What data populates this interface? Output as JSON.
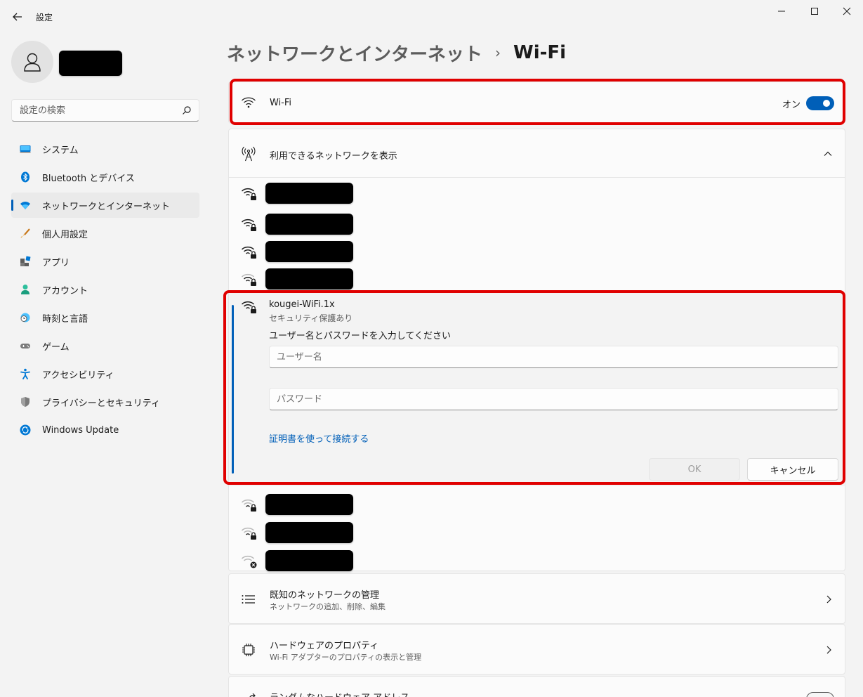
{
  "window": {
    "title": "設定",
    "controls": [
      "minimize",
      "maximize",
      "close"
    ]
  },
  "sidebar": {
    "search": {
      "placeholder": "設定の検索"
    },
    "items": [
      {
        "label": "システム",
        "icon": "system-display-icon"
      },
      {
        "label": "Bluetooth とデバイス",
        "icon": "bluetooth-icon"
      },
      {
        "label": "ネットワークとインターネット",
        "icon": "network-wifi-icon",
        "active": true
      },
      {
        "label": "個人用設定",
        "icon": "paintbrush-icon"
      },
      {
        "label": "アプリ",
        "icon": "apps-icon"
      },
      {
        "label": "アカウント",
        "icon": "account-icon"
      },
      {
        "label": "時刻と言語",
        "icon": "clock-globe-icon"
      },
      {
        "label": "ゲーム",
        "icon": "gamepad-icon"
      },
      {
        "label": "アクセシビリティ",
        "icon": "accessibility-icon"
      },
      {
        "label": "プライバシーとセキュリティ",
        "icon": "shield-icon"
      },
      {
        "label": "Windows Update",
        "icon": "windows-update-icon"
      }
    ]
  },
  "breadcrumb": {
    "parent": "ネットワークとインターネット",
    "separator": "›",
    "current": "Wi-Fi"
  },
  "wifi_toggle": {
    "label": "Wi-Fi",
    "state_label": "オン",
    "on": true
  },
  "networks": {
    "header": "利用できるネットワークを表示",
    "expanded": {
      "name": "kougei-WiFi.1x",
      "security": "セキュリティ保護あり",
      "prompt": "ユーザー名とパスワードを入力してください",
      "username_placeholder": "ユーザー名",
      "password_placeholder": "パスワード",
      "cert_link": "証明書を使って接続する",
      "ok_label": "OK",
      "cancel_label": "キャンセル"
    }
  },
  "settings_rows": [
    {
      "title": "既知のネットワークの管理",
      "subtitle": "ネットワークの追加、削除、編集"
    },
    {
      "title": "ハードウェアのプロパティ",
      "subtitle": "Wi-Fi アダプターのプロパティの表示と管理"
    },
    {
      "title": "ランダムなハードウェア アドレス"
    }
  ],
  "colors": {
    "accent": "#005fb8",
    "highlight": "#e00000",
    "background": "#f3f3f3",
    "card": "#fbfbfb"
  }
}
